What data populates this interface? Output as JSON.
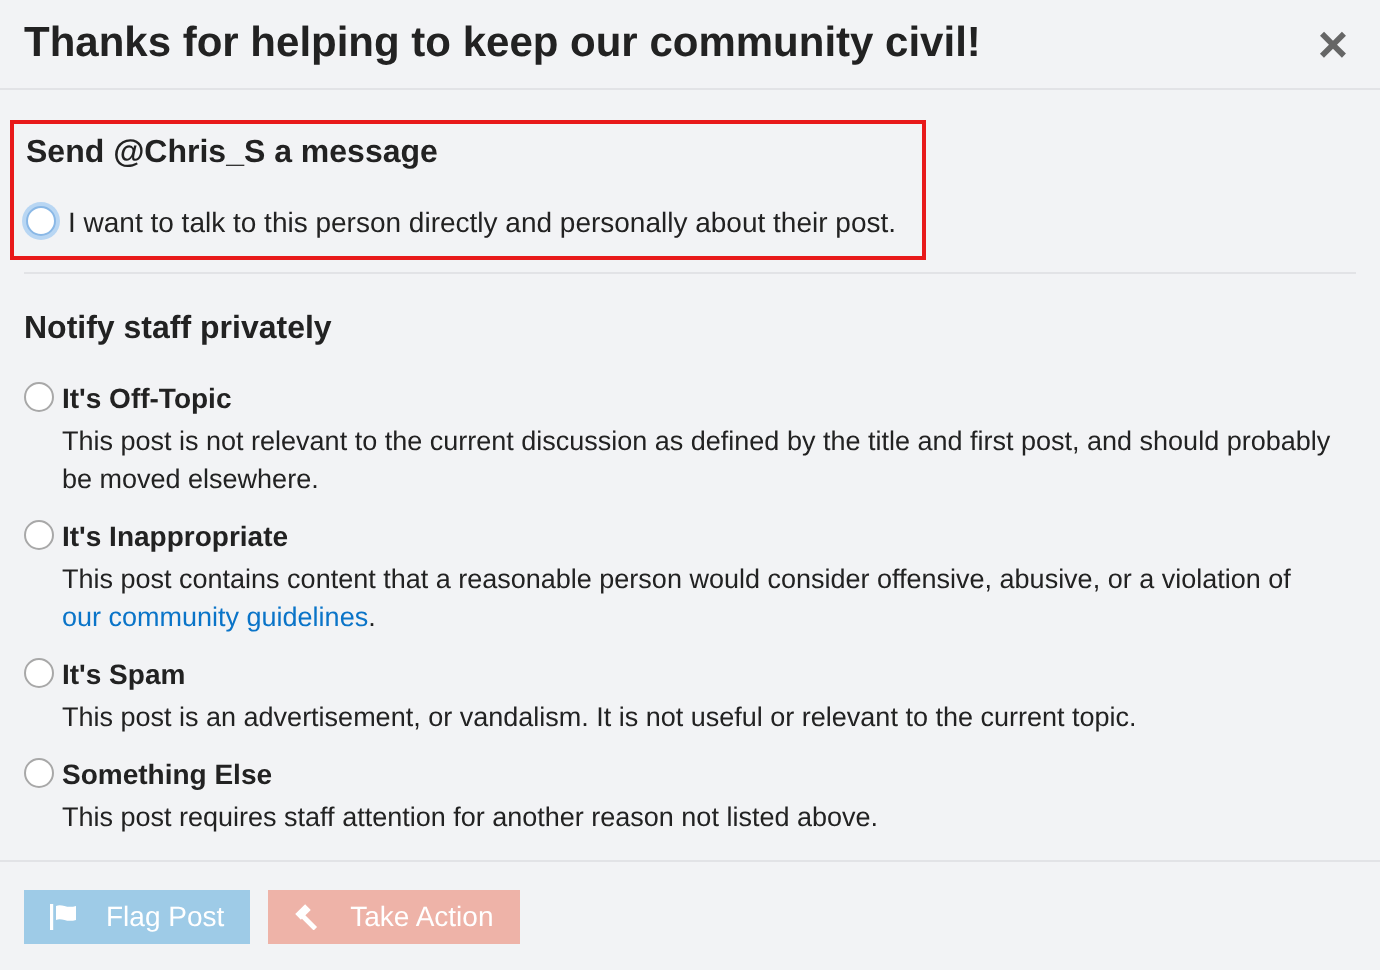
{
  "modal": {
    "title": "Thanks for helping to keep our community civil!",
    "close": "×"
  },
  "message_section": {
    "heading": "Send @Chris_S a message",
    "highlighted": true,
    "option": {
      "label": "I want to talk to this person directly and personally about their post.",
      "selected": false,
      "focused": true
    }
  },
  "staff_section": {
    "heading": "Notify staff privately",
    "options": [
      {
        "title": "It's Off-Topic",
        "selected": false,
        "description": [
          {
            "kind": "text",
            "text": "This post is not relevant to the current discussion as defined by the title and first post, and should probably be moved elsewhere."
          }
        ]
      },
      {
        "title": "It's Inappropriate",
        "selected": false,
        "description": [
          {
            "kind": "text",
            "text": "This post contains content that a reasonable person would consider offensive, abusive, or a violation of "
          },
          {
            "kind": "link",
            "text": "our community guidelines"
          },
          {
            "kind": "text",
            "text": "."
          }
        ]
      },
      {
        "title": "It's Spam",
        "selected": false,
        "description": [
          {
            "kind": "text",
            "text": "This post is an advertisement, or vandalism. It is not useful or relevant to the current topic."
          }
        ]
      },
      {
        "title": "Something Else",
        "selected": false,
        "description": [
          {
            "kind": "text",
            "text": "This post requires staff attention for another reason not listed above."
          }
        ]
      }
    ]
  },
  "buttons": [
    {
      "kind": "flag",
      "label": "Flag Post",
      "disabled": true
    },
    {
      "kind": "action",
      "label": "Take Action",
      "disabled": true
    }
  ]
}
